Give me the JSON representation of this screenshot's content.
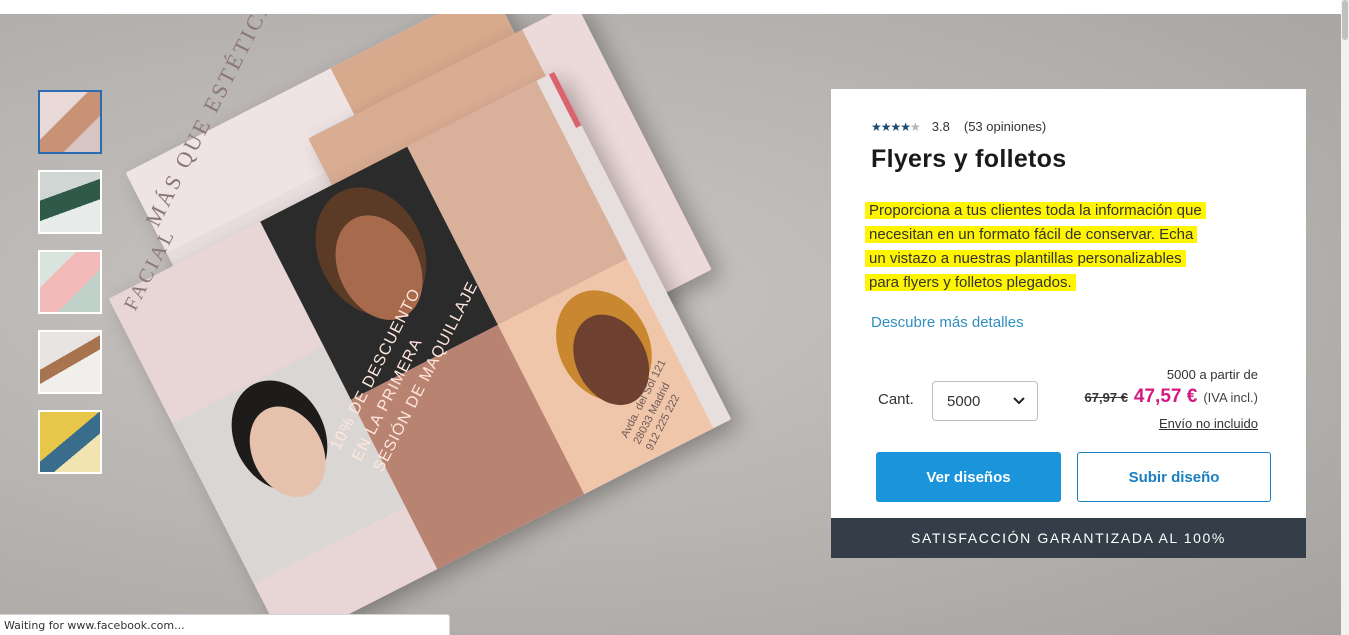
{
  "gallery": {
    "thumbnails": [
      {
        "label": "",
        "active": true
      },
      {
        "label": "",
        "active": false
      },
      {
        "label": "",
        "active": false
      },
      {
        "label": "",
        "active": false
      },
      {
        "label": "",
        "active": false
      }
    ],
    "flyer_text": {
      "title_line1": "MÁS QUE ESTÉTICA FACIAL",
      "title_short": "FACIAL",
      "promo_line1": "10% DE DESCUENTO",
      "promo_line2": "EN LA PRIMERA",
      "promo_line3": "SESIÓN DE MAQUILLAJE",
      "address_line1": "Avda. del Sol 121",
      "address_line2": "28033 Madrid",
      "address_line3": "912 225 222"
    }
  },
  "product": {
    "rating_value": "3.8",
    "rating_stars": 3.8,
    "reviews": "(53 opiniones)",
    "title": "Flyers y folletos",
    "description_lines": [
      "Proporciona a tus clientes toda la información que",
      "necesitan en un formato fácil de conservar. Echa",
      "un vistazo a nuestras plantillas personalizables",
      "para flyers y folletos plegados."
    ],
    "details_link": "Descubre más detalles",
    "quantity_label": "Cant.",
    "quantity_value": "5000",
    "price_from": "5000 a partir de",
    "old_price": "67,97 €",
    "new_price": "47,57 €",
    "vat": "(IVA incl.)",
    "shipping": "Envío no incluido",
    "btn_view": "Ver diseños",
    "btn_upload": "Subir diseño",
    "guarantee": "SATISFACCIÓN GARANTIZADA AL 100%"
  },
  "status_bar": "Waiting for www.facebook.com...",
  "colors": {
    "accent_blue": "#1a95dc",
    "price_pink": "#d6177f",
    "highlight": "#fff500",
    "guarantee_bg": "#333e48",
    "link_blue": "#2f8fbf"
  }
}
